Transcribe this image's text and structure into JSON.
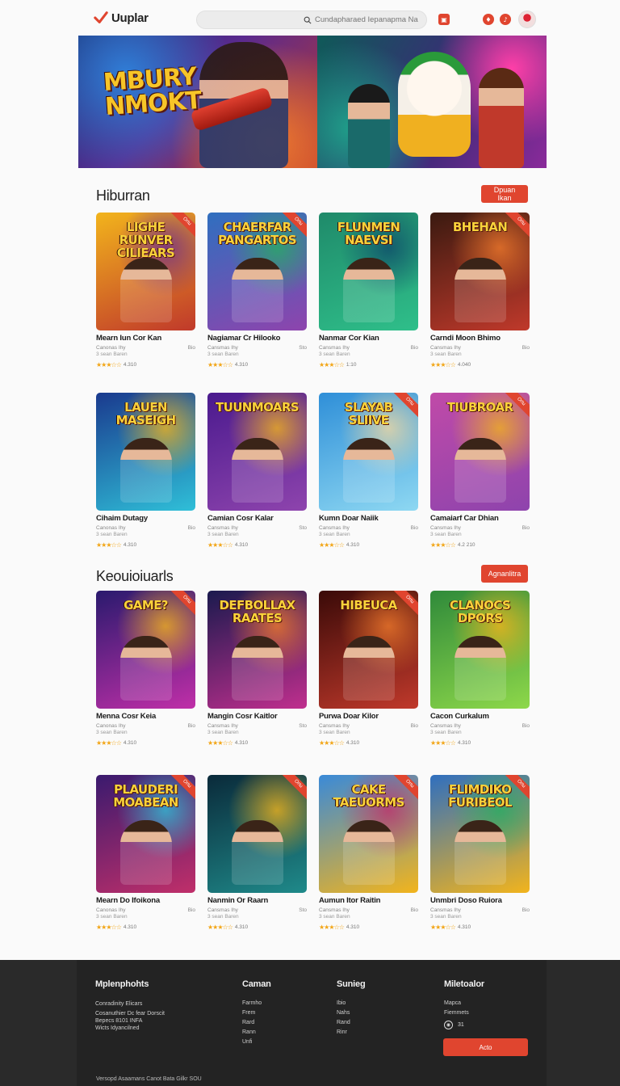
{
  "brand": {
    "name": "Uuplar",
    "accent": "#e0452f"
  },
  "header": {
    "search_placeholder": "Cundapharaed Iepanapma Nam"
  },
  "banner": {
    "title_line1": "MBURY",
    "title_line2": "NMOKT"
  },
  "sections": [
    {
      "title": "Hiburran",
      "button": "Dpuan Ikan",
      "cards": [
        {
          "art": "LIGHE RUNVER CILIEARS",
          "title": "Mearn Iun Cor Kan",
          "meta": "Canonas Ihy",
          "meta_right": "Bio",
          "meta2": "3 sean Baren",
          "rating": "4.310",
          "ribbon": "Ortu"
        },
        {
          "art": "CHAERFAR PANGARTOS",
          "title": "Nagiamar Cr Hilooko",
          "meta": "Cansmas Ihy",
          "meta_right": "Sto",
          "meta2": "3 sean Baren",
          "rating": "4.310",
          "ribbon": "Ortu"
        },
        {
          "art": "FLUNMEN NAEVSI",
          "title": "Nanmar Cor Kian",
          "meta": "Cansmas Ihy",
          "meta_right": "Bio",
          "meta2": "3 sean Baren",
          "rating": "1:10",
          "ribbon": ""
        },
        {
          "art": "BHEHAN",
          "title": "Carndi Moon Bhimo",
          "meta": "Cansmas Ihy",
          "meta_right": "Bio",
          "meta2": "3 sean Baren",
          "rating": "4.040",
          "ribbon": "Ortu"
        }
      ]
    },
    {
      "title": "",
      "button": "",
      "cards": [
        {
          "art": "LAUEN MASEIGH",
          "title": "Cihaim Dutagy",
          "meta": "Canonas Ihy",
          "meta_right": "Bio",
          "meta2": "3 sean Baren",
          "rating": "4.310",
          "ribbon": ""
        },
        {
          "art": "TUUNMOARS",
          "title": "Camian Cosr Kalar",
          "meta": "Cansmas Ihy",
          "meta_right": "Sto",
          "meta2": "3 sean Baren",
          "rating": "4.310",
          "ribbon": ""
        },
        {
          "art": "SLAYAB SLIIVE",
          "title": "Kumn Doar Naiik",
          "meta": "Cansmas Ihy",
          "meta_right": "Bio",
          "meta2": "3 sean Baren",
          "rating": "4.310",
          "ribbon": "Ortu"
        },
        {
          "art": "TIUBROAR",
          "title": "Camaiarf Car Dhian",
          "meta": "Cansmas Ihy",
          "meta_right": "Bio",
          "meta2": "3 sean Baren",
          "rating": "4.2 210",
          "ribbon": "Ortu"
        }
      ]
    },
    {
      "title": "Keouioiuarls",
      "button": "Agnanlitra",
      "cards": [
        {
          "art": "GAME?",
          "title": "Menna Cosr Keia",
          "meta": "Canonas Ihy",
          "meta_right": "Bio",
          "meta2": "3 sean Baren",
          "rating": "4.310",
          "ribbon": "Ortu"
        },
        {
          "art": "DEFBOLLAX RAATES",
          "title": "Mangin Cosr Kaitlor",
          "meta": "Cansmas Ihy",
          "meta_right": "Sto",
          "meta2": "3 sean Baren",
          "rating": "4.310",
          "ribbon": ""
        },
        {
          "art": "HIBEUCA",
          "title": "Purwa Doar Kilor",
          "meta": "Cansmas Ihy",
          "meta_right": "Bio",
          "meta2": "3 sean Baren",
          "rating": "4.310",
          "ribbon": "Ortu"
        },
        {
          "art": "CLANOCS DPORS",
          "title": "Cacon Curkalum",
          "meta": "Cansmas Ihy",
          "meta_right": "Bio",
          "meta2": "3 sean Baren",
          "rating": "4.310",
          "ribbon": ""
        }
      ]
    },
    {
      "title": "",
      "button": "",
      "cards": [
        {
          "art": "PLAUDERI MOABEAN",
          "title": "Mearn Do Ifoikona",
          "meta": "Canonas Ihy",
          "meta_right": "Bio",
          "meta2": "3 sean Baren",
          "rating": "4.310",
          "ribbon": "Ortu"
        },
        {
          "art": "",
          "title": "Nanmin Or Raarn",
          "meta": "Cansmas Ihy",
          "meta_right": "Sto",
          "meta2": "3 sean Baren",
          "rating": "4.310",
          "ribbon": "Ortu"
        },
        {
          "art": "CAKE TAEUORMS",
          "title": "Aumun Itor Raitin",
          "meta": "Cansmas Ihy",
          "meta_right": "Bio",
          "meta2": "3 sean Baren",
          "rating": "4.310",
          "ribbon": "Ortu"
        },
        {
          "art": "FLIMDIKO FURIBEOL",
          "title": "Unmbri Doso Ruiora",
          "meta": "Cansmas Ihy",
          "meta_right": "Bio",
          "meta2": "3 sean Baren",
          "rating": "4.310",
          "ribbon": "Ortu"
        }
      ]
    }
  ],
  "footer": {
    "col1": {
      "head": "Mplenphohts",
      "lines": [
        "Conradinity Elicars",
        "Cosanuthier Dc fear Dorscit",
        "Bepecs 8101 INFA",
        "Wicts Idyancilned"
      ]
    },
    "col2": {
      "head": "Caman",
      "links": [
        "Farmho",
        "Frem",
        "Rard",
        "Rann",
        "Unfi"
      ]
    },
    "col3": {
      "head": "Sunieg",
      "links": [
        "Ibio",
        "Nahs",
        "Rand",
        "Rinr"
      ]
    },
    "col4": {
      "head": "Miletoalor",
      "links": [
        "Mapca",
        "Fiemmets"
      ],
      "follow_count": "31",
      "button": "Acto"
    },
    "copyright": "Versopd Asaamans Canot Bata Gilkr SOU"
  }
}
